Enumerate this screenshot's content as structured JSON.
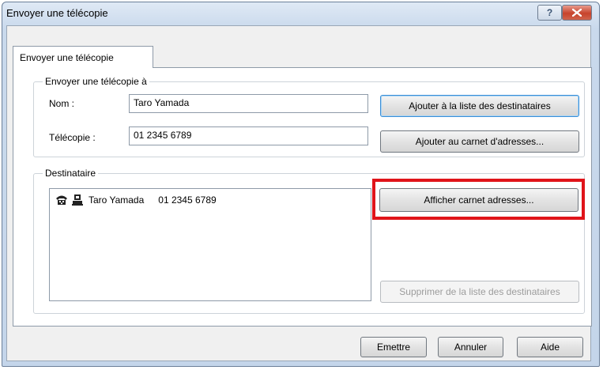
{
  "window": {
    "title": "Envoyer une télécopie"
  },
  "titlebar": {
    "help_icon": "question-icon",
    "close_icon": "close-icon"
  },
  "tabs": [
    {
      "label": "Envoyer une télécopie",
      "selected": true
    }
  ],
  "send_group": {
    "label": "Envoyer une télécopie à",
    "name_label": "Nom :",
    "name_value": "Taro Yamada",
    "fax_label": "Télécopie :",
    "fax_value": "01 2345 6789",
    "add_to_list_button": "Ajouter à la liste des destinataires",
    "add_to_address_book_button": "Ajouter au carnet d'adresses..."
  },
  "recipient_group": {
    "label": "Destinataire",
    "items": [
      {
        "name": "Taro Yamada",
        "fax": "01 2345 6789",
        "icons": [
          "fax-icon",
          "person-icon"
        ]
      }
    ],
    "show_address_book_button": "Afficher carnet adresses...",
    "remove_button": "Supprimer de la liste des destinataires"
  },
  "footer": {
    "send_button": "Emettre",
    "cancel_button": "Annuler",
    "help_button": "Aide"
  },
  "colors": {
    "highlight": "#e0141a",
    "close_button": "#c7432c"
  }
}
